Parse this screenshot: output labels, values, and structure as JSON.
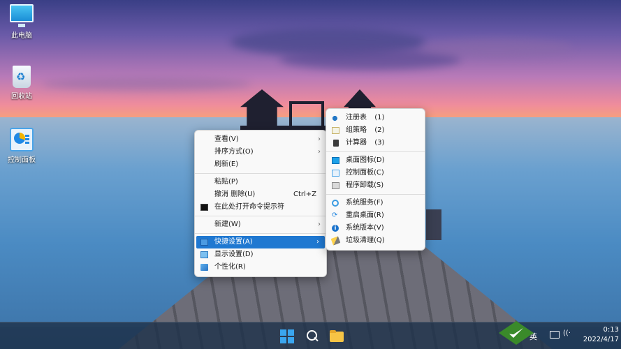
{
  "desktop": {
    "icons": [
      {
        "label": "此电脑",
        "icon": "this-pc-icon"
      },
      {
        "label": "回收站",
        "icon": "recycle-bin-icon"
      },
      {
        "label": "控制面板",
        "icon": "control-panel-icon"
      }
    ]
  },
  "context_menu": {
    "items": [
      {
        "label": "查看(V)",
        "submenu": true
      },
      {
        "label": "排序方式(O)",
        "submenu": true
      },
      {
        "label": "刷新(E)"
      },
      {
        "label": "粘贴(P)"
      },
      {
        "label": "撤消 删除(U)",
        "shortcut": "Ctrl+Z"
      },
      {
        "label": "在此处打开命令提示符",
        "icon": "cmd-icon"
      },
      {
        "label": "新建(W)",
        "submenu": true
      },
      {
        "label": "快捷设置(A)",
        "submenu": true,
        "highlighted": true,
        "icon": "quick-settings-icon"
      },
      {
        "label": "显示设置(D)",
        "icon": "display-settings-icon"
      },
      {
        "label": "个性化(R)",
        "icon": "personalize-icon"
      }
    ]
  },
  "submenu": {
    "items": [
      {
        "label": "注册表",
        "key": "(1)",
        "icon": "registry-icon"
      },
      {
        "label": "组策略",
        "key": "(2)",
        "icon": "group-policy-icon"
      },
      {
        "label": "计算器",
        "key": "(3)",
        "icon": "calculator-icon"
      },
      {
        "label": "桌面图标(D)",
        "icon": "desktop-icons-icon"
      },
      {
        "label": "控制面板(C)",
        "icon": "control-panel-icon"
      },
      {
        "label": "程序卸载(S)",
        "icon": "uninstall-icon"
      },
      {
        "label": "系统服务(F)",
        "icon": "services-icon"
      },
      {
        "label": "重启桌面(R)",
        "icon": "restart-desktop-icon"
      },
      {
        "label": "系统版本(V)",
        "icon": "info-icon"
      },
      {
        "label": "垃圾清理(Q)",
        "icon": "cleanup-icon"
      }
    ]
  },
  "taskbar": {
    "tray_lang": "英",
    "clock_time": "0:13",
    "clock_date": "2022/4/17",
    "restart_glyph": "⟳",
    "info_glyph": "i",
    "wifi_glyph": "((·"
  },
  "colors": {
    "highlight": "#1f78d1",
    "menu_bg": "#f9f9f9",
    "win_blue": "#3aa6f0"
  }
}
